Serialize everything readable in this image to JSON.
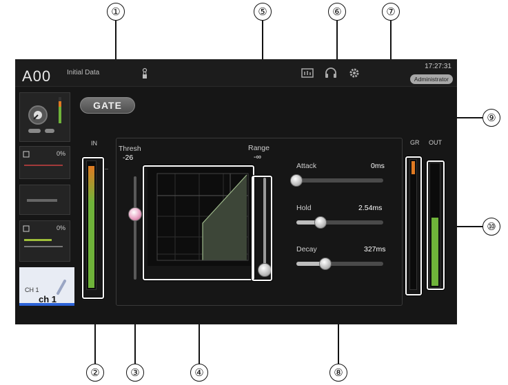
{
  "callouts": [
    "①",
    "②",
    "③",
    "④",
    "⑤",
    "⑥",
    "⑦",
    "⑧",
    "⑨",
    "⑩"
  ],
  "topbar": {
    "scene_number": "A00",
    "scene_title": "Initial Data",
    "clock": "17:27:31",
    "user_badge": "Administrator",
    "icons": [
      "lock-icon",
      "meter-icon",
      "headphones-icon",
      "gear-icon"
    ]
  },
  "left_panel": {
    "row1_value": "0%",
    "row2_value": "0%",
    "channel_id": "CH 1",
    "channel_name": "ch 1"
  },
  "gate": {
    "button_label": "GATE",
    "in_label": "IN",
    "threshold_label": "Thresh",
    "threshold_value": "-26",
    "threshold_level": 0.55,
    "range_label": "Range",
    "range_value": "-∞",
    "range_level": 0.0,
    "attack_label": "Attack",
    "attack_value": "0ms",
    "attack_level": 0.0,
    "hold_label": "Hold",
    "hold_value": "2.54ms",
    "hold_level": 0.28,
    "decay_label": "Decay",
    "decay_value": "327ms",
    "decay_level": 0.33,
    "gr_label": "GR",
    "out_label": "OUT",
    "in_meter_level": 0.95,
    "gr_meter_level": 0.1,
    "out_meter_level": 0.55
  },
  "colors": {
    "background": "#161616",
    "meter_green": "#6fb33a",
    "meter_orange": "#e07a22",
    "highlight": "#ffffff"
  }
}
